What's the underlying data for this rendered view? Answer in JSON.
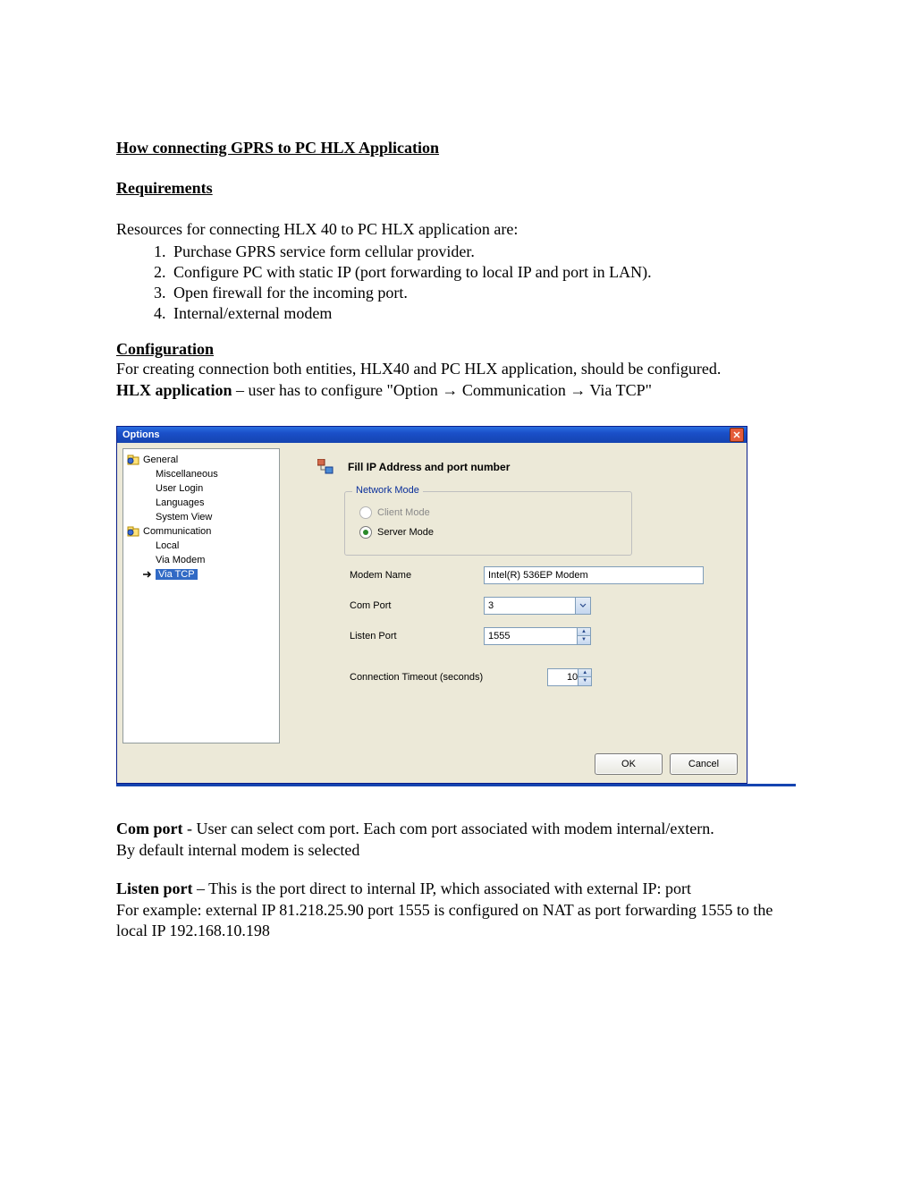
{
  "doc": {
    "title": "How connecting GPRS to PC HLX Application",
    "req_header": "Requirements",
    "req_intro": "Resources for connecting HLX 40 to PC HLX application are:",
    "reqs": [
      "Purchase GPRS service form cellular provider.",
      "Configure PC with static IP (port forwarding to local IP and port in LAN).",
      "Open firewall for the incoming port.",
      "Internal/external modem"
    ],
    "conf_header": "Configuration",
    "conf_p1": "For creating connection both entities, HLX40 and PC HLX application, should be configured.",
    "conf_p2_bold": "HLX application",
    "conf_p2_rest": " – user has to configure \"Option → Communication → Via TCP\"",
    "comport_bold": "Com port",
    "comport_rest": " - User can select com port. Each com port associated with modem internal/extern.",
    "comport_l2": "By default internal modem is selected",
    "listen_bold": "Listen port",
    "listen_rest": " – This is the port direct to internal IP, which associated with external IP: port",
    "listen_l2": "For example: external IP 81.218.25.90 port 1555 is configured on NAT as port forwarding 1555 to the local IP 192.168.10.198"
  },
  "dialog": {
    "title": "Options",
    "tree": {
      "general": "General",
      "misc": "Miscellaneous",
      "userlogin": "User Login",
      "languages": "Languages",
      "sysview": "System View",
      "comm": "Communication",
      "local": "Local",
      "viamodem": "Via Modem",
      "viatcp": "Via TCP"
    },
    "section_title": "Fill IP Address and port number",
    "fieldset_legend": "Network Mode",
    "radio_client": "Client Mode",
    "radio_server": "Server Mode",
    "labels": {
      "modem": "Modem Name",
      "comport": "Com Port",
      "listen": "Listen Port",
      "timeout": "Connection Timeout (seconds)"
    },
    "values": {
      "modem": "Intel(R) 536EP Modem",
      "comport": "3",
      "listen": "1555",
      "timeout": "10"
    },
    "ok": "OK",
    "cancel": "Cancel"
  }
}
